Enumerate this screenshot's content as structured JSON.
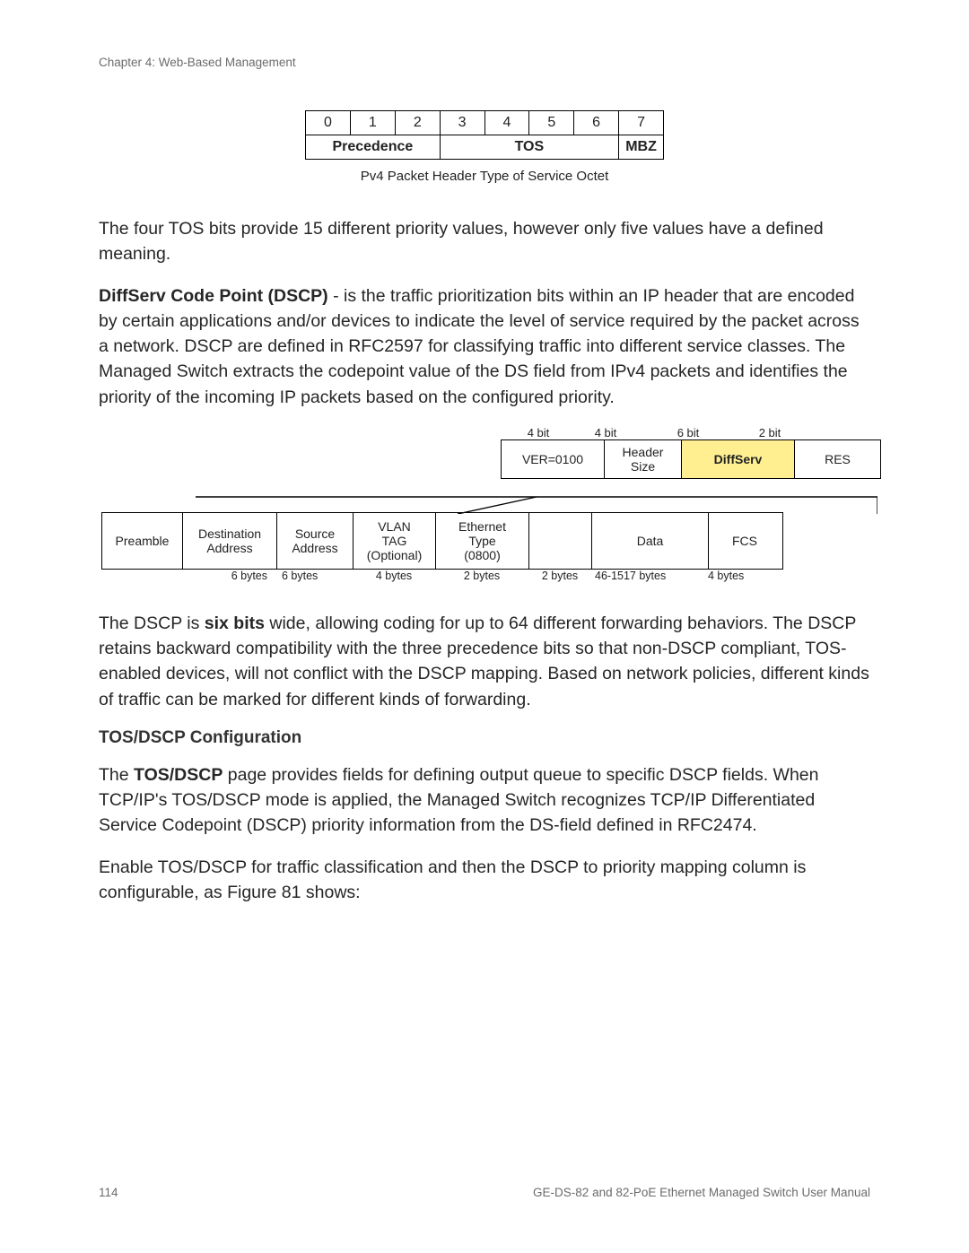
{
  "chapter": "Chapter 4: Web-Based Management",
  "tos_octet": {
    "bits": [
      "0",
      "1",
      "2",
      "3",
      "4",
      "5",
      "6",
      "7"
    ],
    "labels": {
      "precedence": "Precedence",
      "tos": "TOS",
      "mbz": "MBZ"
    },
    "caption": "Pv4 Packet Header Type of Service Octet"
  },
  "para1": "The four TOS bits provide 15 different priority values, however only five values have a defined meaning.",
  "dscp_lead": "DiffServ Code Point (DSCP)",
  "dscp_body": " - is the traffic prioritization bits within an IP header that are encoded by certain applications and/or devices to indicate the level of service required by the packet across a network. DSCP are defined in RFC2597 for classifying traffic into different service classes. The Managed Switch extracts the codepoint value of the DS field from IPv4 packets and identifies the priority of the incoming IP packets based on the configured priority.",
  "ip_header": {
    "bits": [
      "4 bit",
      "4 bit",
      "6 bit",
      "2 bit"
    ],
    "cells": [
      "VER=0100",
      "Header Size",
      "DiffServ",
      "RES"
    ]
  },
  "eth_frame": {
    "fields": [
      {
        "name": "Preamble",
        "bytes": ""
      },
      {
        "name": "Destination Address",
        "bytes": "6 bytes"
      },
      {
        "name": "Source Address",
        "bytes": "6 bytes"
      },
      {
        "name": "VLAN TAG (Optional)",
        "bytes": "4 bytes",
        "lines": [
          "VLAN",
          "TAG",
          "(Optional)"
        ]
      },
      {
        "name": "Ethernet Type (0800)",
        "bytes": "2 bytes",
        "lines": [
          "Ethernet",
          "Type",
          "(0800)"
        ]
      },
      {
        "name": "",
        "bytes": "2 bytes"
      },
      {
        "name": "Data",
        "bytes": "46-1517 bytes"
      },
      {
        "name": "FCS",
        "bytes": "4 bytes"
      }
    ]
  },
  "para2_a": "The DSCP is ",
  "para2_b": "six bits",
  "para2_c": " wide, allowing coding for up to 64 different forwarding behaviors. The DSCP retains backward compatibility with the three precedence bits so that non-DSCP compliant, TOS-enabled devices, will not conflict with the DSCP mapping. Based on network policies, different kinds of traffic can be marked for different kinds of forwarding.",
  "section_head": "TOS/DSCP Configuration",
  "para3_a": "The ",
  "para3_b": "TOS/DSCP",
  "para3_c": " page provides fields for defining output queue to specific DSCP fields. When TCP/IP's TOS/DSCP mode is applied, the Managed Switch recognizes TCP/IP Differentiated Service Codepoint (DSCP) priority information from the DS-field defined in RFC2474.",
  "para4": "Enable TOS/DSCP for traffic classification and then the DSCP to priority mapping column is configurable, as Figure 81 shows:",
  "footer": {
    "page": "114",
    "manual": "GE-DS-82 and 82-PoE Ethernet Managed Switch User Manual"
  }
}
